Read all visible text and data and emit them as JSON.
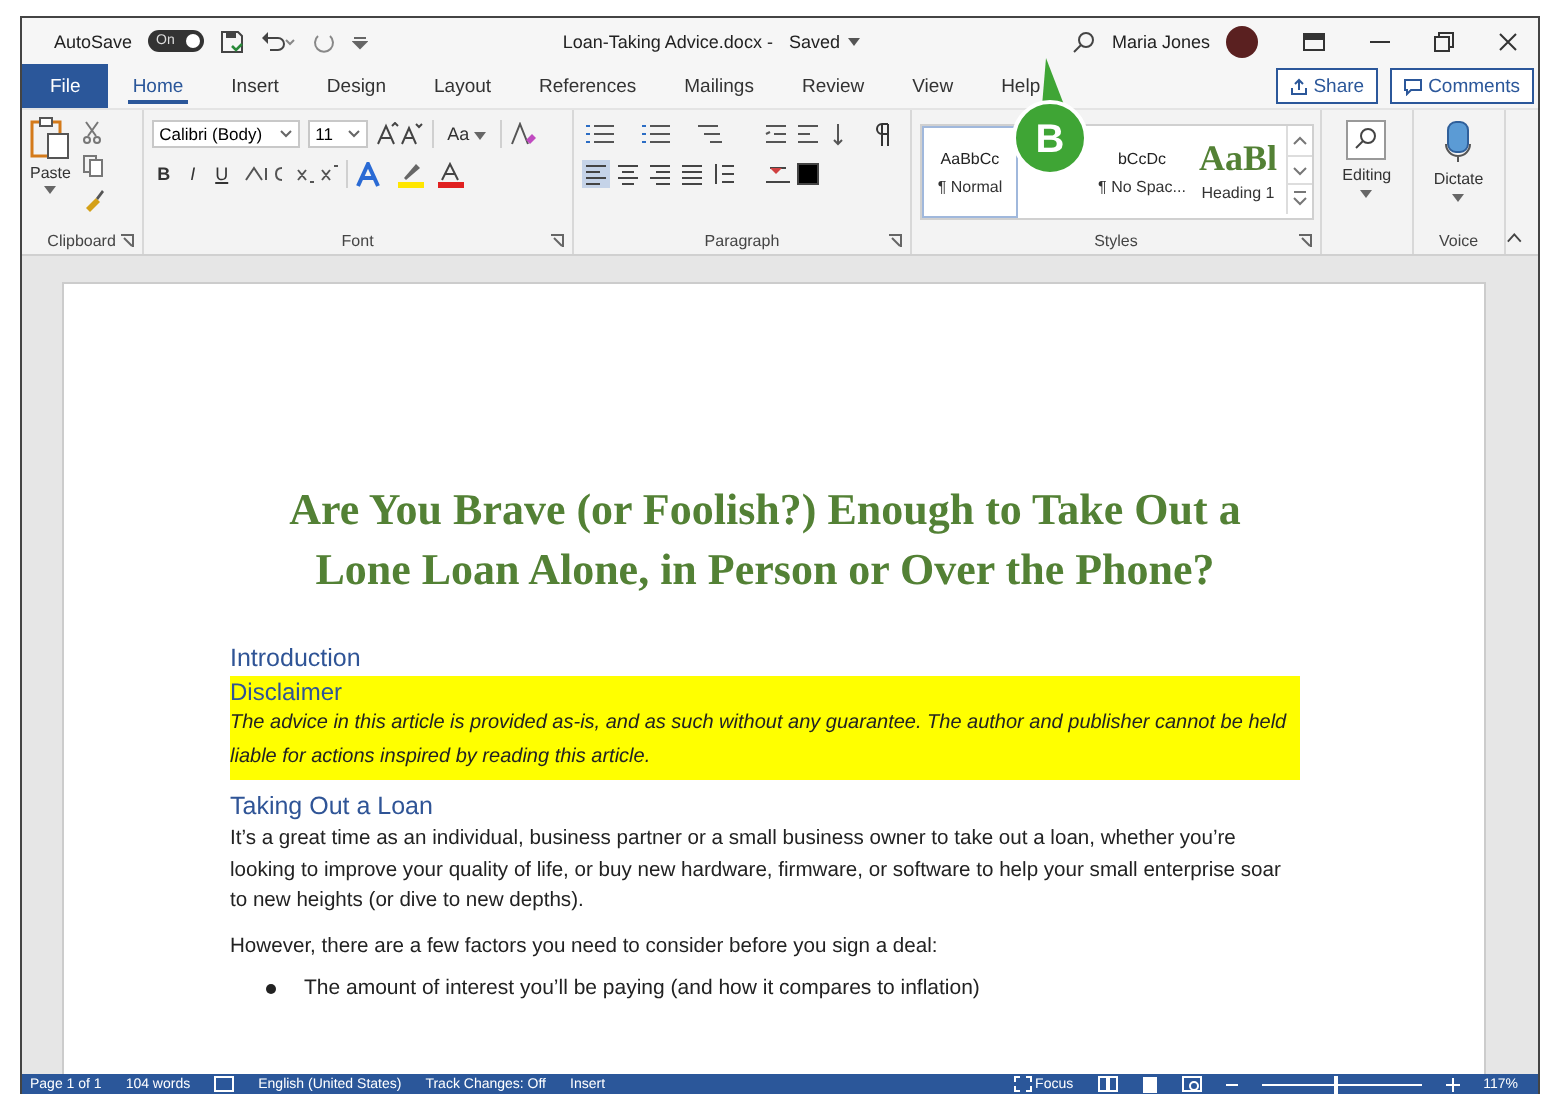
{
  "title_bar": {
    "autosave_label": "AutoSave",
    "autosave_toggle": {
      "label": "On",
      "on": true
    },
    "document_title": "Loan-Taking Advice.docx -",
    "save_status": "Saved",
    "user_name": "Maria Jones"
  },
  "tabs": [
    {
      "label": "File",
      "kind": "file",
      "selected": false
    },
    {
      "label": "Home",
      "kind": "tab",
      "selected": true
    },
    {
      "label": "Insert",
      "kind": "tab",
      "selected": false
    },
    {
      "label": "Design",
      "kind": "tab",
      "selected": false
    },
    {
      "label": "Layout",
      "kind": "tab",
      "selected": false
    },
    {
      "label": "References",
      "kind": "tab",
      "selected": false
    },
    {
      "label": "Mailings",
      "kind": "tab",
      "selected": false
    },
    {
      "label": "Review",
      "kind": "tab",
      "selected": false
    },
    {
      "label": "View",
      "kind": "tab",
      "selected": false
    },
    {
      "label": "Help",
      "kind": "tab",
      "selected": false
    }
  ],
  "share_button": "Share",
  "comments_button": "Comments",
  "ribbon": {
    "clipboard": {
      "paste": "Paste",
      "label": "Clipboard"
    },
    "font": {
      "font_name": "Calibri (Body)",
      "font_size": "11",
      "change_case": "Aa",
      "format_buttons": [
        "B",
        "I",
        "U"
      ],
      "label": "Font"
    },
    "paragraph": {
      "label": "Paragraph"
    },
    "styles": {
      "items": [
        {
          "preview": "AaBbCc",
          "name": "¶ Normal",
          "kind": "normal",
          "selected": true
        },
        {
          "preview": "bCcDc",
          "name": "¶ No Spac...",
          "kind": "normal",
          "selected": false
        },
        {
          "preview": "AaBl",
          "name": "Heading 1",
          "kind": "heading",
          "selected": false
        }
      ],
      "label": "Styles"
    },
    "editing": "Editing",
    "dictate": "Dictate",
    "voice_label": "Voice"
  },
  "callout": "B",
  "document": {
    "title": "Are You Brave (or Foolish?) Enough to Take Out a Lone Loan Alone, in Person or Over the Phone?",
    "blocks": [
      {
        "kind": "heading",
        "text": "Introduction"
      },
      {
        "kind": "highlight_heading",
        "text": "Disclaimer"
      },
      {
        "kind": "highlight_italic",
        "text": "The advice in this article is provided as-is, and as such without any guarantee. The author and publisher cannot be held liable for actions inspired by reading this article."
      },
      {
        "kind": "heading",
        "text": "Taking Out a Loan"
      },
      {
        "kind": "paragraph",
        "text": "It’s a great time as an individual, business partner or a small business owner to take out a loan, whether you’re looking to improve your quality of life, or buy new  hardware, firmware, or software to help your small enterprise soar to new heights (or dive to new depths)."
      },
      {
        "kind": "paragraph",
        "text": "However, there are a few factors you need to consider before you sign a deal:"
      },
      {
        "kind": "bullet",
        "text": "The amount of interest you’ll be paying (and how it compares to inflation)"
      }
    ]
  },
  "status_bar": {
    "page": "Page 1 of 1",
    "words": "104 words",
    "language": "English (United States)",
    "track_changes": "Track Changes: Off",
    "mode": "Insert",
    "focus": "Focus",
    "zoom": {
      "level": 0.45,
      "reading": "117%"
    }
  }
}
